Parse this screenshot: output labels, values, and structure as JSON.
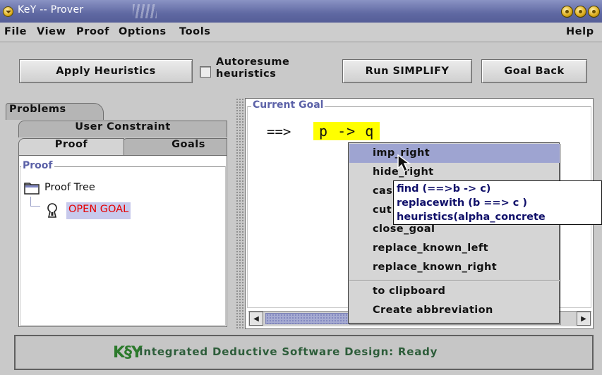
{
  "window": {
    "title": "KeY -- Prover"
  },
  "menu": {
    "file": "File",
    "view": "View",
    "proof": "Proof",
    "options": "Options",
    "tools": "Tools",
    "help": "Help"
  },
  "toolbar": {
    "apply_heuristics": "Apply Heuristics",
    "autoresume_line1": "Autoresume",
    "autoresume_line2": "heuristics",
    "autoresume_checked": false,
    "run_simplify": "Run SIMPLIFY",
    "goal_back": "Goal Back"
  },
  "tabs": {
    "problems": "Problems",
    "user_constraint": "User Constraint",
    "proof": "Proof",
    "goals": "Goals",
    "active": "Proof"
  },
  "proof_panel": {
    "legend": "Proof",
    "root": "Proof Tree",
    "node": "OPEN GOAL"
  },
  "goal_panel": {
    "legend": "Current Goal",
    "arrow": "==>",
    "formula": "p -> q"
  },
  "popup": {
    "items": [
      "imp_right",
      "hide_right",
      "cas",
      "cut",
      "close_goal",
      "replace_known_left",
      "replace_known_right"
    ],
    "selected": "imp_right",
    "extra": [
      "to clipboard",
      "Create abbreviation"
    ]
  },
  "tooltip": {
    "line1": "find (==>b -> c)",
    "line2": "replacewith (b ==> c )",
    "line3": "heuristics(alpha_concrete"
  },
  "status": {
    "logo": "K§Y",
    "text": "Integrated Deductive Software Design: Ready"
  },
  "colors": {
    "titlebar": "#5f68a2",
    "selection": "#9ea4d1",
    "highlight": "#ffff00",
    "open_goal": "#e60000",
    "legend": "#5c62a8"
  }
}
